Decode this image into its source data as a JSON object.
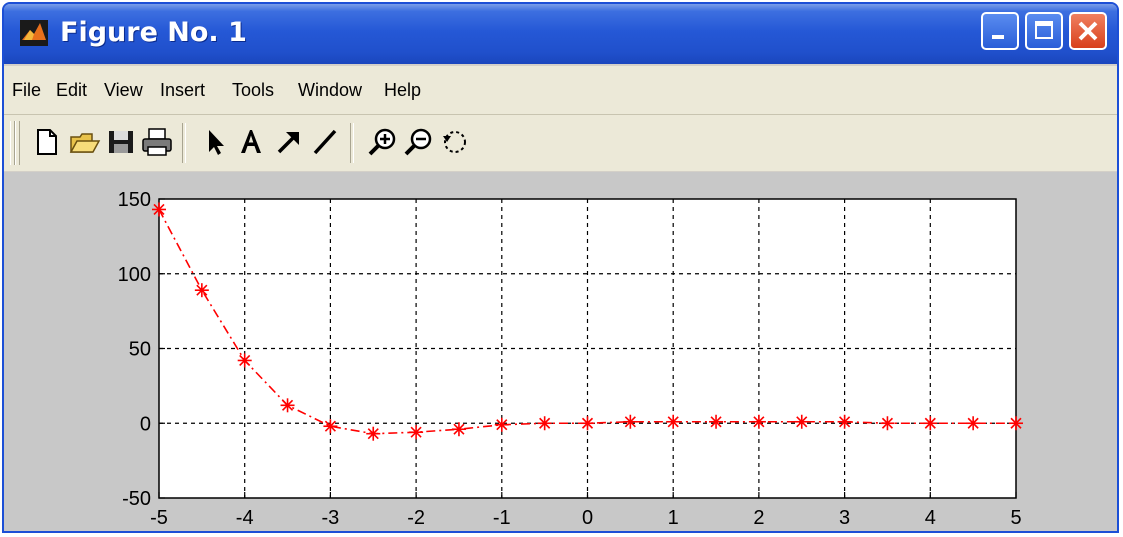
{
  "window": {
    "title": "Figure No. 1"
  },
  "menu": {
    "items": [
      "File",
      "Edit",
      "View",
      "Insert",
      "Tools",
      "Window",
      "Help"
    ]
  },
  "toolbar": {
    "buttons": [
      "new-file-icon",
      "open-folder-icon",
      "save-icon",
      "print-icon",
      "edit-plot-arrow-icon",
      "insert-text-icon",
      "insert-arrow-icon",
      "insert-line-icon",
      "zoom-in-icon",
      "zoom-out-icon",
      "rotate-3d-icon"
    ]
  },
  "chart_data": {
    "type": "line",
    "x": [
      -5,
      -4.5,
      -4,
      -3.5,
      -3,
      -2.5,
      -2,
      -1.5,
      -1,
      -0.5,
      0,
      0.5,
      1,
      1.5,
      2,
      2.5,
      3,
      3.5,
      4,
      4.5,
      5
    ],
    "series": [
      {
        "values": [
          143,
          89,
          42,
          12,
          -2,
          -7,
          -6,
          -4,
          -1,
          0,
          0,
          1,
          1,
          1,
          1,
          1,
          1,
          0,
          0,
          0,
          0
        ],
        "color": "#ff0000",
        "line_style": "dash-dot",
        "marker": "*"
      }
    ],
    "xlim": [
      -5,
      5
    ],
    "ylim": [
      -50,
      150
    ],
    "xticks": [
      "-5",
      "-4",
      "-3",
      "-2",
      "-1",
      "0",
      "1",
      "2",
      "3",
      "4",
      "5"
    ],
    "yticks": [
      "150",
      "100",
      "50",
      "0",
      "-50"
    ],
    "grid": true,
    "title": "",
    "xlabel": "",
    "ylabel": ""
  }
}
